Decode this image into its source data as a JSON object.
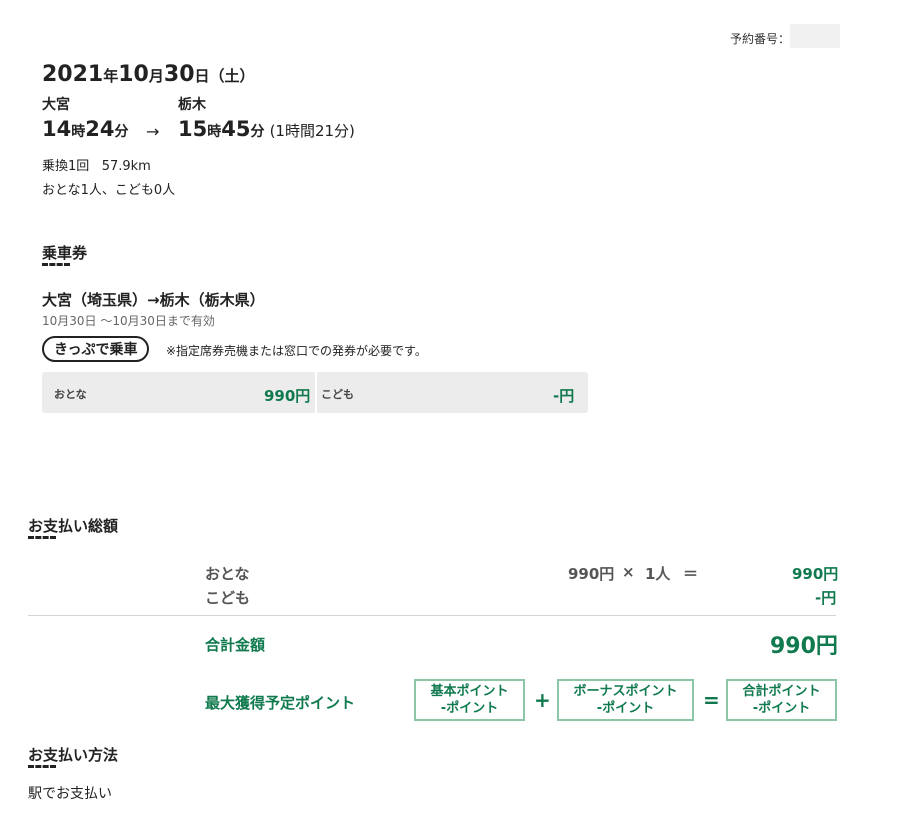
{
  "reservation": {
    "label": "予約番号："
  },
  "header": {
    "year": "2021",
    "year_unit": "年",
    "month": "10",
    "month_unit": "月",
    "day": "30",
    "day_unit": "日",
    "weekday": "（土）"
  },
  "trip": {
    "from": "大宮",
    "to": "栃木",
    "dep_h": "14",
    "dep_h_unit": "時",
    "dep_m": "24",
    "dep_m_unit": "分",
    "arrow": "→",
    "arr_h": "15",
    "arr_h_unit": "時",
    "arr_m": "45",
    "arr_m_unit": "分",
    "duration": "(1時間21分)",
    "transfers": "乗換1回",
    "distance": "57.9km",
    "passengers": "おとな1人、こども0人"
  },
  "ticket": {
    "title": "乗車券",
    "route": "大宮（埼玉県）→栃木（栃木県）",
    "validity": "10月30日 ～10月30日まで有効",
    "pill": "きっぷで乗車",
    "note": "※指定席券売機または窓口での発券が必要です。",
    "fares": [
      {
        "label": "おとな",
        "value": "990円"
      },
      {
        "label": "こども",
        "value": "-円"
      }
    ]
  },
  "payment_total": {
    "title": "お支払い総額",
    "rows": [
      {
        "label": "おとな",
        "unit_price": "990円",
        "times": "×",
        "count": "1人",
        "equals": "＝",
        "amount": "990円"
      },
      {
        "label": "こども",
        "amount": "-円"
      }
    ],
    "total_label": "合計金額",
    "total_value": "990円",
    "points_label": "最大獲得予定ポイント",
    "points": [
      {
        "name": "基本ポイント",
        "value": "-ポイント"
      },
      {
        "name": "ボーナスポイント",
        "value": "-ポイント"
      },
      {
        "name": "合計ポイント",
        "value": "-ポイント"
      }
    ],
    "plus": "+",
    "eq": "="
  },
  "payment_method": {
    "title": "お支払い方法",
    "value": "駅でお支払い"
  }
}
